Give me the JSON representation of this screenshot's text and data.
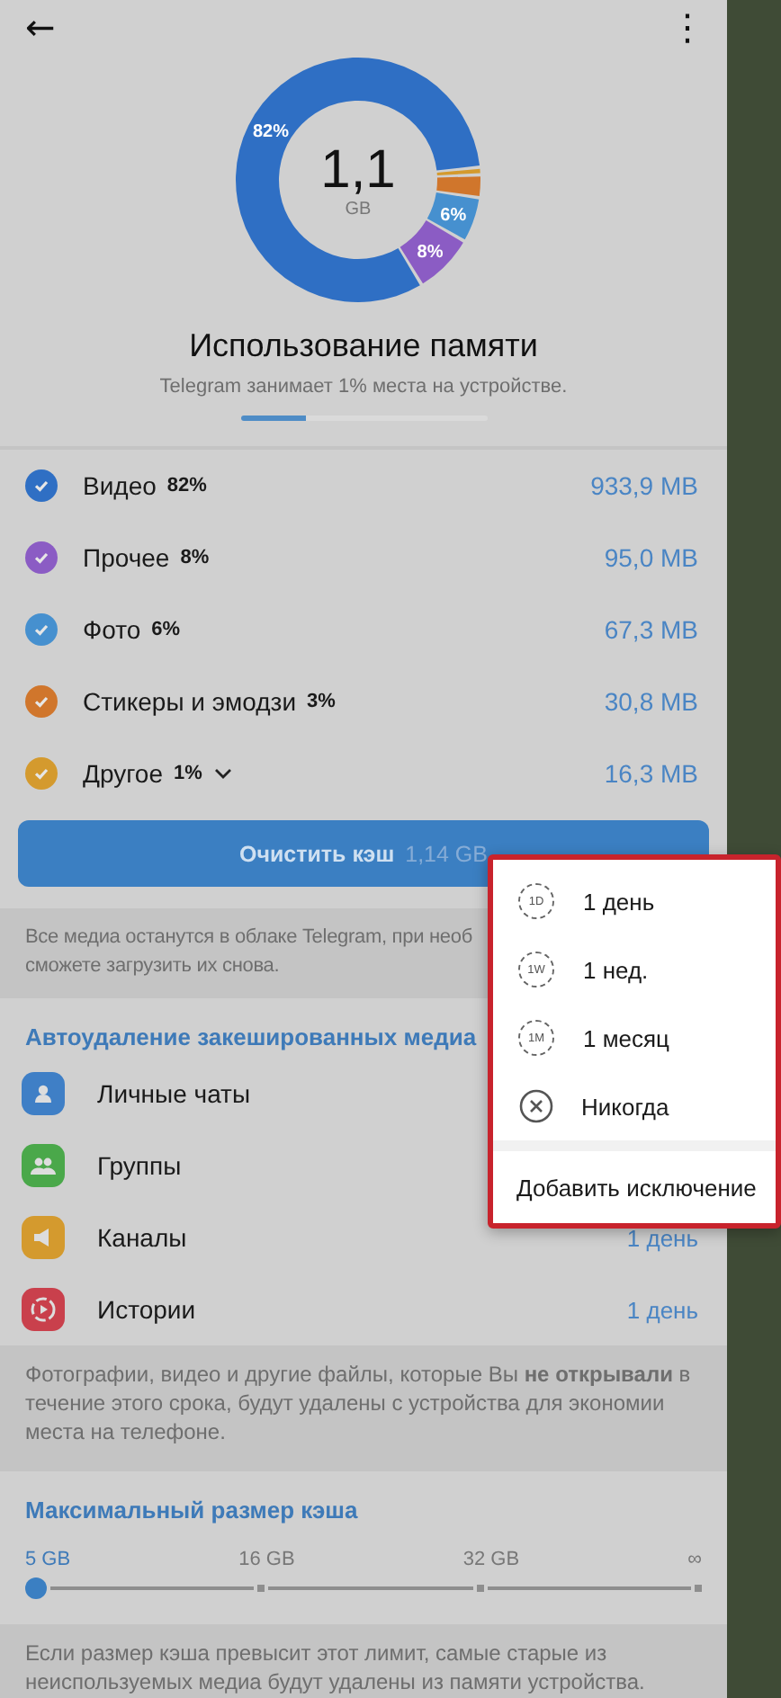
{
  "header": {
    "back": "←",
    "menu": "⋮"
  },
  "usage": {
    "total": "1,1",
    "unit": "GB",
    "title": "Использование памяти",
    "subtitle": "Telegram занимает 1% места на устройстве.",
    "level": 0.27,
    "slice_labels": [
      "82%",
      "8%",
      "6%"
    ]
  },
  "categories": [
    {
      "name": "Видео",
      "percent": "82%",
      "size": "933,9 MB",
      "checked": true,
      "color": "#2f6fc4"
    },
    {
      "name": "Прочее",
      "percent": "8%",
      "size": "95,0 MB",
      "checked": true,
      "color": "#8b5cc4"
    },
    {
      "name": "Фото",
      "percent": "6%",
      "size": "67,3 MB",
      "checked": true,
      "color": "#4690cf"
    },
    {
      "name": "Стикеры и эмодзи",
      "percent": "3%",
      "size": "30,8 MB",
      "checked": true,
      "color": "#d0762c"
    },
    {
      "name": "Другое",
      "percent": "1%",
      "size": "16,3 MB",
      "checked": true,
      "color": "#d49a2e",
      "expanded": false
    }
  ],
  "clear_button": {
    "label": "Очистить кэш",
    "size": "1,14 GB"
  },
  "clear_note": "Все медиа останутся в облаке Telegram, при необ",
  "clear_note_2": "сможете загрузить их снова.",
  "auto_delete": {
    "header": "Автоудаление закешированных медиа",
    "rows": [
      {
        "kind": "private",
        "label": "Личные чаты",
        "color": "#3f7fc6"
      },
      {
        "kind": "groups",
        "label": "Группы",
        "color": "#4aa84a"
      },
      {
        "kind": "channels",
        "label": "Каналы",
        "value": "1 день",
        "color": "#d49a2e"
      },
      {
        "kind": "stories",
        "label": "Истории",
        "value": "1 день",
        "color": "#c9404c"
      }
    ],
    "note": "Фотографии, видео и другие файлы, которые Вы **не открывали** в течение этого срока, будут удалены с устройства для экономии места на телефоне."
  },
  "cache_size": {
    "header": "Максимальный размер кэша",
    "ticks": [
      {
        "label": "5 GB",
        "selected": true
      },
      {
        "label": "16 GB",
        "selected": false
      },
      {
        "label": "32 GB",
        "selected": false
      },
      {
        "label": "∞",
        "selected": false
      }
    ],
    "level": 0,
    "note": "Если размер кэша превысит этот лимит, самые старые из неиспользуемых медиа будут удалены из памяти устройства."
  },
  "popup_menu": {
    "highlighted": true,
    "items": [
      {
        "kind": "timer",
        "icon_label": "1D",
        "label": "1 день"
      },
      {
        "kind": "timer",
        "icon_label": "1W",
        "label": "1 нед."
      },
      {
        "kind": "timer",
        "icon_label": "1M",
        "label": "1 месяц"
      },
      {
        "kind": "never",
        "label": "Никогда"
      },
      {
        "kind": "action",
        "label": "Добавить исключение"
      }
    ]
  }
}
